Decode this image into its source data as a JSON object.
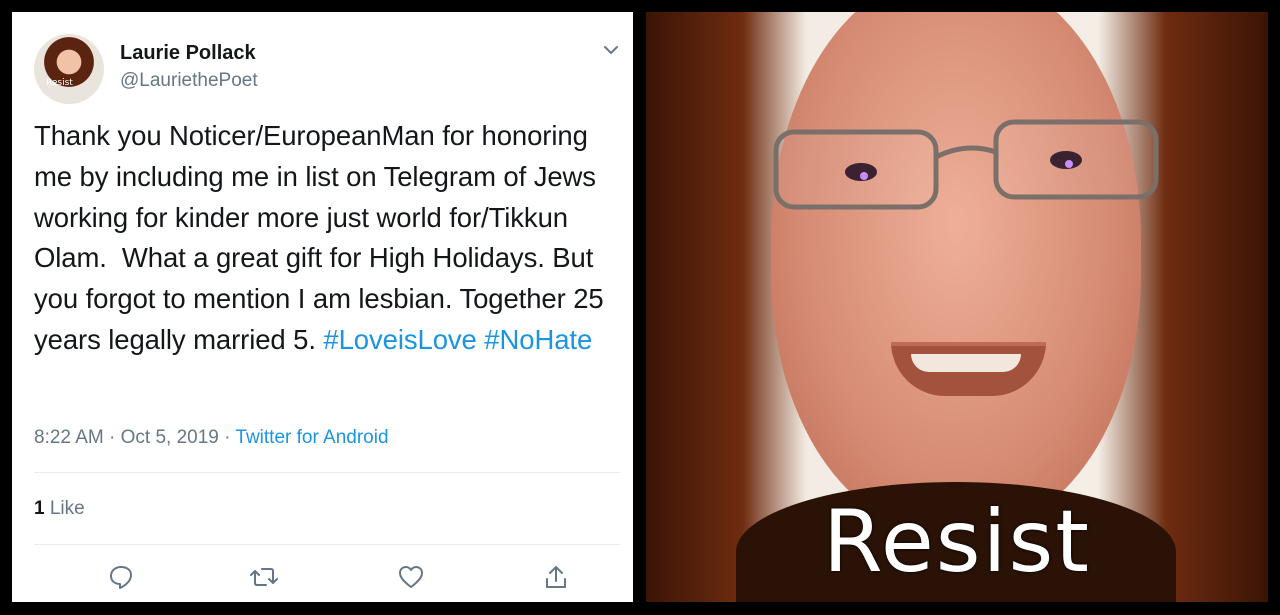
{
  "tweet": {
    "display_name": "Laurie Pollack",
    "handle": "@LauriethePoet",
    "avatar_label": "Resist",
    "text_main": "Thank you Noticer/EuropeanMan for honoring me by including me in list on Telegram of Jews working for kinder more just world for/Tikkun Olam.  What a great gift for High Holidays. But you forgot to mention I am lesbian. Together 25 years legally married 5. ",
    "hashtags": [
      "#LoveisLove",
      "#NoHate"
    ],
    "time": "8:22 AM",
    "date": "Oct 5, 2019",
    "separator": "·",
    "source": "Twitter for Android",
    "like_count": "1",
    "like_label": "Like"
  },
  "actions": [
    "reply-icon",
    "retweet-icon",
    "like-icon",
    "share-icon"
  ],
  "photo": {
    "caption": "Resist"
  },
  "colors": {
    "link": "#1b95e0",
    "secondary_text": "#657786",
    "primary_text": "#14171a",
    "divider": "#e6ecf0"
  }
}
